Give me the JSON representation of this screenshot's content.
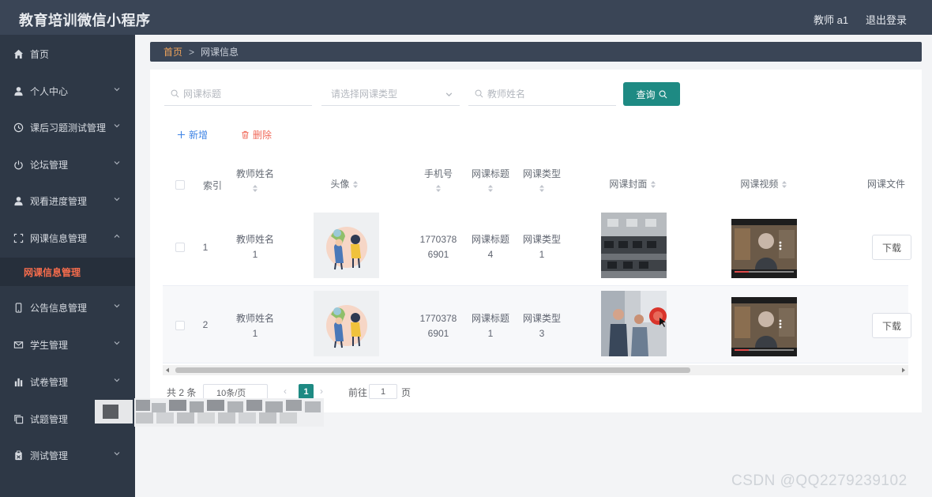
{
  "header": {
    "title": "教育培训微信小程序",
    "user": "教师 a1",
    "logout": "退出登录"
  },
  "sidebar": {
    "items": [
      {
        "label": "首页",
        "icon": "home-icon",
        "has_arrow": false
      },
      {
        "label": "个人中心",
        "icon": "user-icon",
        "has_arrow": true
      },
      {
        "label": "课后习题测试管理",
        "icon": "clock-icon",
        "has_arrow": true
      },
      {
        "label": "论坛管理",
        "icon": "power-icon",
        "has_arrow": true
      },
      {
        "label": "观看进度管理",
        "icon": "user-icon",
        "has_arrow": true
      },
      {
        "label": "网课信息管理",
        "icon": "fullscreen-icon",
        "has_arrow": true,
        "expanded": true
      },
      {
        "label": "公告信息管理",
        "icon": "phone-icon",
        "has_arrow": true
      },
      {
        "label": "学生管理",
        "icon": "mail-icon",
        "has_arrow": true
      },
      {
        "label": "试卷管理",
        "icon": "bar-chart-icon",
        "has_arrow": true
      },
      {
        "label": "试题管理",
        "icon": "copy-icon",
        "has_arrow": false
      },
      {
        "label": "测试管理",
        "icon": "clipboard-icon",
        "has_arrow": true
      }
    ],
    "active_sub": "网课信息管理"
  },
  "breadcrumb": {
    "home": "首页",
    "separator": ">",
    "current": "网课信息"
  },
  "search": {
    "title_placeholder": "网课标题",
    "type_placeholder": "请选择网课类型",
    "teacher_placeholder": "教师姓名",
    "button": "查询"
  },
  "actions": {
    "add": "新增",
    "delete": "删除"
  },
  "table": {
    "headers": {
      "index": "索引",
      "teacher_name": "教师姓名",
      "avatar": "头像",
      "phone": "手机号",
      "course_title": "网课标题",
      "course_type": "网课类型",
      "cover": "网课封面",
      "video": "网课视频",
      "file": "网课文件"
    },
    "rows": [
      {
        "index": "1",
        "name_1": "教师姓名",
        "name_2": "1",
        "phone_1": "1770378",
        "phone_2": "6901",
        "title_1": "网课标题",
        "title_2": "4",
        "type_1": "网课类型",
        "type_2": "1",
        "download": "下载"
      },
      {
        "index": "2",
        "name_1": "教师姓名",
        "name_2": "1",
        "phone_1": "1770378",
        "phone_2": "6901",
        "title_1": "网课标题",
        "title_2": "1",
        "type_1": "网课类型",
        "type_2": "3",
        "download": "下载"
      }
    ]
  },
  "pagination": {
    "total": "共 2 条",
    "page_size": "10条/页",
    "current": "1",
    "goto_label": "前往",
    "goto_value": "1",
    "page_label": "页",
    "prev": "‹",
    "next": "›"
  },
  "watermark": "CSDN @QQ2279239102",
  "colors": {
    "header_bg": "#3a4556",
    "sidebar_bg": "#2e3846",
    "accent": "#1e8a83",
    "active_menu": "#f56c4c",
    "add_blue": "#3f84e5",
    "delete_red": "#f06a5a"
  }
}
